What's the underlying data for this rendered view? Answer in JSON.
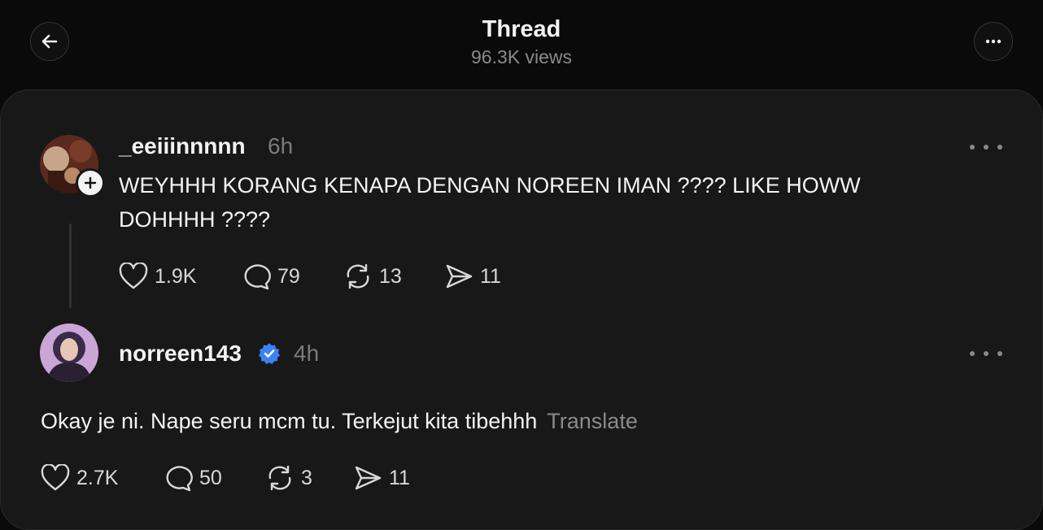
{
  "header": {
    "title": "Thread",
    "views": "96.3K views",
    "back_icon": "arrow-left-icon",
    "menu_icon": "more-horizontal-icon"
  },
  "post": {
    "username": "_eeiiinnnnn",
    "time": "6h",
    "text": "WEYHHH KORANG KENAPA DENGAN NOREEN IMAN ???? LIKE HOWW DOHHHH ????",
    "likes": "1.9K",
    "comments": "79",
    "reposts": "13",
    "shares": "11"
  },
  "reply": {
    "username": "norreen143",
    "verified": true,
    "time": "4h",
    "text": "Okay je ni. Nape seru mcm tu. Terkejut kita tibehhh",
    "translate_label": "Translate",
    "likes": "2.7K",
    "comments": "50",
    "reposts": "3",
    "shares": "11"
  },
  "colors": {
    "background": "#0a0a0a",
    "card": "#181818",
    "muted": "#7a7a7a",
    "verified": "#3b82f6"
  }
}
